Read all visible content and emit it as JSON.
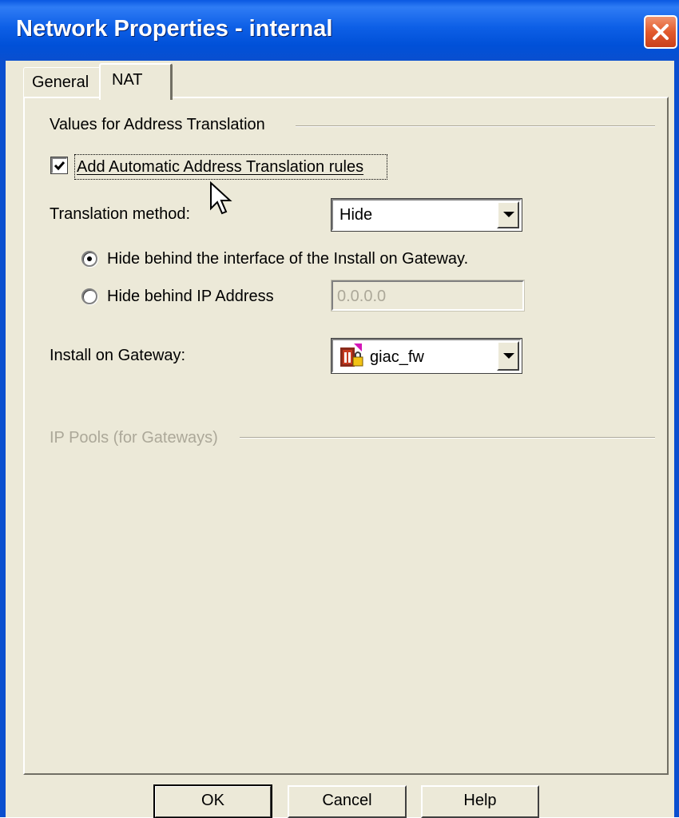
{
  "window": {
    "title": "Network Properties - internal"
  },
  "tabs": [
    {
      "label": "General",
      "selected": false
    },
    {
      "label": "NAT",
      "selected": true
    }
  ],
  "nat": {
    "group_title": "Values for Address Translation",
    "auto_rules_checkbox": {
      "label": "Add Automatic Address Translation rules",
      "checked": true
    },
    "translation_method": {
      "label": "Translation method:",
      "value": "Hide"
    },
    "hide_options": [
      {
        "label": "Hide behind the interface of the Install on Gateway.",
        "selected": true
      },
      {
        "label": "Hide behind IP Address",
        "selected": false
      }
    ],
    "ip_address": {
      "value": "0.0.0.0",
      "enabled": false
    },
    "install_on_gateway": {
      "label": "Install on Gateway:",
      "value": "giac_fw",
      "icon": "gateway-icon"
    },
    "ip_pools_group_title": "IP Pools (for Gateways)"
  },
  "buttons": {
    "ok": "OK",
    "cancel": "Cancel",
    "help": "Help"
  },
  "colors": {
    "titlebar": "#0a58e2",
    "close": "#e25a2d",
    "face": "#ece9d8",
    "disabled_text": "#aca899"
  }
}
